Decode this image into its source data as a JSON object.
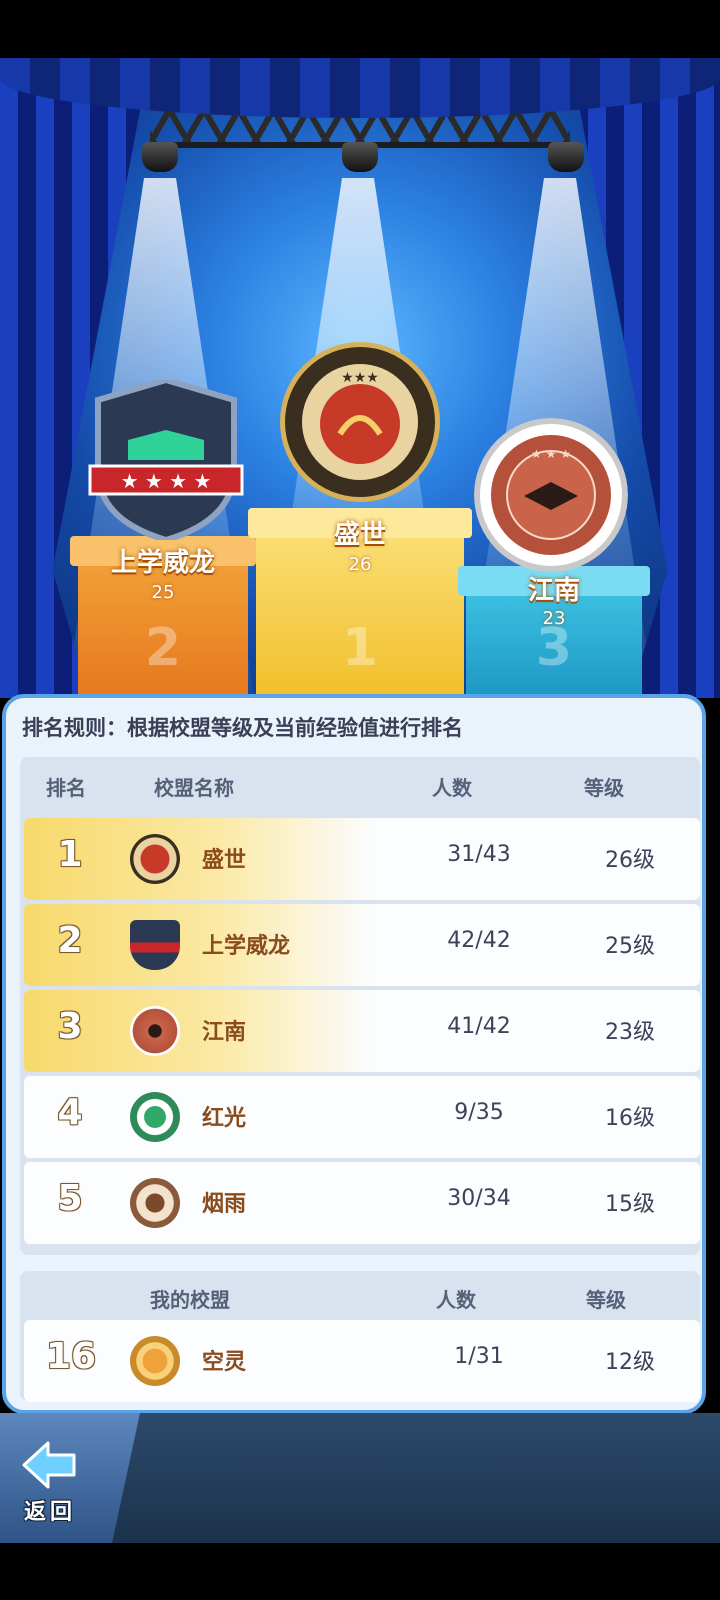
{
  "podium": [
    {
      "place": "1",
      "name": "盛世",
      "level": "26"
    },
    {
      "place": "2",
      "name": "上学威龙",
      "level": "25"
    },
    {
      "place": "3",
      "name": "江南",
      "level": "23"
    }
  ],
  "rule_text": "排名规则：根据校盟等级及当前经验值进行排名",
  "table_headers": {
    "rank": "排名",
    "name": "校盟名称",
    "members": "人数",
    "level": "等级"
  },
  "rows": [
    {
      "rank": "1",
      "name": "盛世",
      "members": "31/43",
      "level": "26级",
      "icon": "gold-laurel-badge-icon"
    },
    {
      "rank": "2",
      "name": "上学威龙",
      "members": "42/42",
      "level": "25级",
      "icon": "book-shield-icon"
    },
    {
      "rank": "3",
      "name": "江南",
      "members": "41/42",
      "level": "23级",
      "icon": "graduation-cap-badge-icon"
    },
    {
      "rank": "4",
      "name": "红光",
      "members": "9/35",
      "level": "16级",
      "icon": "green-sprout-badge-icon"
    },
    {
      "rank": "5",
      "name": "烟雨",
      "members": "30/34",
      "level": "15级",
      "icon": "brown-emblem-badge-icon"
    }
  ],
  "my_headers": {
    "name": "我的校盟",
    "members": "人数",
    "level": "等级"
  },
  "my_row": {
    "rank": "16",
    "name": "空灵",
    "members": "1/31",
    "level": "12级",
    "icon": "gold-coin-badge-icon"
  },
  "back_label": "返回",
  "colors": {
    "panel_border": "#5aa3e8",
    "name_text": "#8a4b1d",
    "gold_podium": "#f5c93b",
    "orange_podium": "#f0902c",
    "blue_podium": "#2fb5d6"
  }
}
